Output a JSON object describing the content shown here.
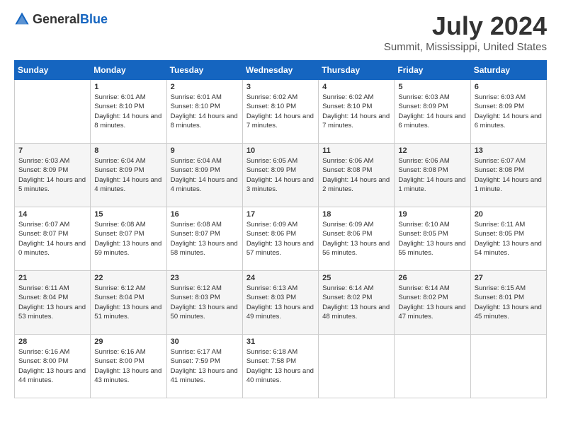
{
  "header": {
    "logo_general": "General",
    "logo_blue": "Blue",
    "title": "July 2024",
    "subtitle": "Summit, Mississippi, United States"
  },
  "days_of_week": [
    "Sunday",
    "Monday",
    "Tuesday",
    "Wednesday",
    "Thursday",
    "Friday",
    "Saturday"
  ],
  "weeks": [
    [
      {
        "day": "",
        "sunrise": "",
        "sunset": "",
        "daylight": ""
      },
      {
        "day": "1",
        "sunrise": "Sunrise: 6:01 AM",
        "sunset": "Sunset: 8:10 PM",
        "daylight": "Daylight: 14 hours and 8 minutes."
      },
      {
        "day": "2",
        "sunrise": "Sunrise: 6:01 AM",
        "sunset": "Sunset: 8:10 PM",
        "daylight": "Daylight: 14 hours and 8 minutes."
      },
      {
        "day": "3",
        "sunrise": "Sunrise: 6:02 AM",
        "sunset": "Sunset: 8:10 PM",
        "daylight": "Daylight: 14 hours and 7 minutes."
      },
      {
        "day": "4",
        "sunrise": "Sunrise: 6:02 AM",
        "sunset": "Sunset: 8:10 PM",
        "daylight": "Daylight: 14 hours and 7 minutes."
      },
      {
        "day": "5",
        "sunrise": "Sunrise: 6:03 AM",
        "sunset": "Sunset: 8:09 PM",
        "daylight": "Daylight: 14 hours and 6 minutes."
      },
      {
        "day": "6",
        "sunrise": "Sunrise: 6:03 AM",
        "sunset": "Sunset: 8:09 PM",
        "daylight": "Daylight: 14 hours and 6 minutes."
      }
    ],
    [
      {
        "day": "7",
        "sunrise": "Sunrise: 6:03 AM",
        "sunset": "Sunset: 8:09 PM",
        "daylight": "Daylight: 14 hours and 5 minutes."
      },
      {
        "day": "8",
        "sunrise": "Sunrise: 6:04 AM",
        "sunset": "Sunset: 8:09 PM",
        "daylight": "Daylight: 14 hours and 4 minutes."
      },
      {
        "day": "9",
        "sunrise": "Sunrise: 6:04 AM",
        "sunset": "Sunset: 8:09 PM",
        "daylight": "Daylight: 14 hours and 4 minutes."
      },
      {
        "day": "10",
        "sunrise": "Sunrise: 6:05 AM",
        "sunset": "Sunset: 8:09 PM",
        "daylight": "Daylight: 14 hours and 3 minutes."
      },
      {
        "day": "11",
        "sunrise": "Sunrise: 6:06 AM",
        "sunset": "Sunset: 8:08 PM",
        "daylight": "Daylight: 14 hours and 2 minutes."
      },
      {
        "day": "12",
        "sunrise": "Sunrise: 6:06 AM",
        "sunset": "Sunset: 8:08 PM",
        "daylight": "Daylight: 14 hours and 1 minute."
      },
      {
        "day": "13",
        "sunrise": "Sunrise: 6:07 AM",
        "sunset": "Sunset: 8:08 PM",
        "daylight": "Daylight: 14 hours and 1 minute."
      }
    ],
    [
      {
        "day": "14",
        "sunrise": "Sunrise: 6:07 AM",
        "sunset": "Sunset: 8:07 PM",
        "daylight": "Daylight: 14 hours and 0 minutes."
      },
      {
        "day": "15",
        "sunrise": "Sunrise: 6:08 AM",
        "sunset": "Sunset: 8:07 PM",
        "daylight": "Daylight: 13 hours and 59 minutes."
      },
      {
        "day": "16",
        "sunrise": "Sunrise: 6:08 AM",
        "sunset": "Sunset: 8:07 PM",
        "daylight": "Daylight: 13 hours and 58 minutes."
      },
      {
        "day": "17",
        "sunrise": "Sunrise: 6:09 AM",
        "sunset": "Sunset: 8:06 PM",
        "daylight": "Daylight: 13 hours and 57 minutes."
      },
      {
        "day": "18",
        "sunrise": "Sunrise: 6:09 AM",
        "sunset": "Sunset: 8:06 PM",
        "daylight": "Daylight: 13 hours and 56 minutes."
      },
      {
        "day": "19",
        "sunrise": "Sunrise: 6:10 AM",
        "sunset": "Sunset: 8:05 PM",
        "daylight": "Daylight: 13 hours and 55 minutes."
      },
      {
        "day": "20",
        "sunrise": "Sunrise: 6:11 AM",
        "sunset": "Sunset: 8:05 PM",
        "daylight": "Daylight: 13 hours and 54 minutes."
      }
    ],
    [
      {
        "day": "21",
        "sunrise": "Sunrise: 6:11 AM",
        "sunset": "Sunset: 8:04 PM",
        "daylight": "Daylight: 13 hours and 53 minutes."
      },
      {
        "day": "22",
        "sunrise": "Sunrise: 6:12 AM",
        "sunset": "Sunset: 8:04 PM",
        "daylight": "Daylight: 13 hours and 51 minutes."
      },
      {
        "day": "23",
        "sunrise": "Sunrise: 6:12 AM",
        "sunset": "Sunset: 8:03 PM",
        "daylight": "Daylight: 13 hours and 50 minutes."
      },
      {
        "day": "24",
        "sunrise": "Sunrise: 6:13 AM",
        "sunset": "Sunset: 8:03 PM",
        "daylight": "Daylight: 13 hours and 49 minutes."
      },
      {
        "day": "25",
        "sunrise": "Sunrise: 6:14 AM",
        "sunset": "Sunset: 8:02 PM",
        "daylight": "Daylight: 13 hours and 48 minutes."
      },
      {
        "day": "26",
        "sunrise": "Sunrise: 6:14 AM",
        "sunset": "Sunset: 8:02 PM",
        "daylight": "Daylight: 13 hours and 47 minutes."
      },
      {
        "day": "27",
        "sunrise": "Sunrise: 6:15 AM",
        "sunset": "Sunset: 8:01 PM",
        "daylight": "Daylight: 13 hours and 45 minutes."
      }
    ],
    [
      {
        "day": "28",
        "sunrise": "Sunrise: 6:16 AM",
        "sunset": "Sunset: 8:00 PM",
        "daylight": "Daylight: 13 hours and 44 minutes."
      },
      {
        "day": "29",
        "sunrise": "Sunrise: 6:16 AM",
        "sunset": "Sunset: 8:00 PM",
        "daylight": "Daylight: 13 hours and 43 minutes."
      },
      {
        "day": "30",
        "sunrise": "Sunrise: 6:17 AM",
        "sunset": "Sunset: 7:59 PM",
        "daylight": "Daylight: 13 hours and 41 minutes."
      },
      {
        "day": "31",
        "sunrise": "Sunrise: 6:18 AM",
        "sunset": "Sunset: 7:58 PM",
        "daylight": "Daylight: 13 hours and 40 minutes."
      },
      {
        "day": "",
        "sunrise": "",
        "sunset": "",
        "daylight": ""
      },
      {
        "day": "",
        "sunrise": "",
        "sunset": "",
        "daylight": ""
      },
      {
        "day": "",
        "sunrise": "",
        "sunset": "",
        "daylight": ""
      }
    ]
  ]
}
